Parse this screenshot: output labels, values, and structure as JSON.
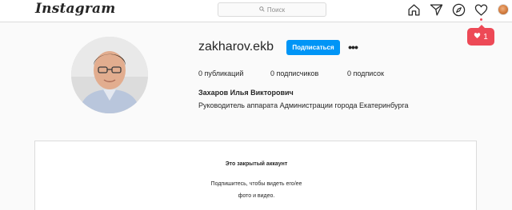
{
  "header": {
    "logo": "Instagram",
    "search_placeholder": "Поиск",
    "icons": [
      "home-icon",
      "direct-icon",
      "explore-icon",
      "activity-heart-icon",
      "profile-avatar"
    ]
  },
  "notification": {
    "count": "1"
  },
  "profile": {
    "username": "zakharov.ekb",
    "follow_label": "Подписаться",
    "more_label": "•••",
    "stats": {
      "posts": "0 публикаций",
      "followers": "0 подписчиков",
      "following": "0 подписок"
    },
    "full_name": "Захаров Илья Викторович",
    "bio": "Руководитель аппарата Администрации города Екатеринбурга"
  },
  "private_notice": {
    "title": "Это закрытый аккаунт",
    "line1": "Подпишитесь, чтобы видеть его/ее",
    "line2": "фото и видео."
  },
  "colors": {
    "accent": "#0095f6",
    "notification": "#ed4956",
    "border": "#dbdbdb",
    "background": "#fafafa"
  }
}
